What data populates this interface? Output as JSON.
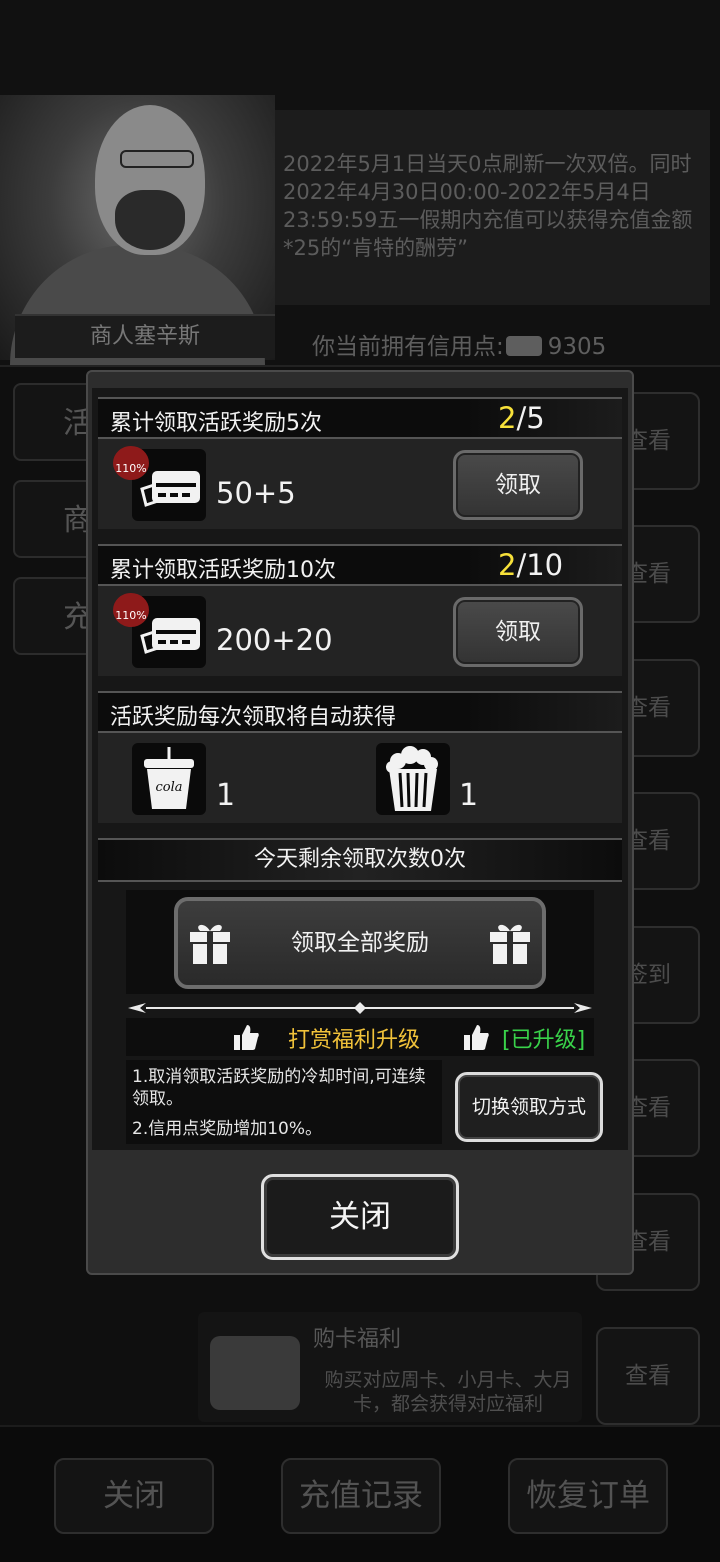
{
  "header": {
    "merchant_name": "商人塞辛斯",
    "notice": "2022年5月1日当天0点刷新一次双倍。同时2022年4月30日00:00-2022年5月4日23:59:59五一假期内充值可以获得充值金额*25的“肯特的酬劳”",
    "credit_label": "你当前拥有信用点:",
    "credit_value": "9305"
  },
  "background": {
    "left_tabs": [
      "活",
      "商",
      "充"
    ],
    "right_buttons": [
      "查看",
      "查看",
      "查看",
      "查看",
      "签到",
      "查看",
      "查看",
      "查看"
    ],
    "card_welfare": {
      "title": "购卡福利",
      "desc": "购买对应周卡、小月卡、大月卡，都会获得对应福利"
    },
    "bottom_buttons": [
      "关闭",
      "充值记录",
      "恢复订单"
    ]
  },
  "modal": {
    "tier1": {
      "title": "累计领取活跃奖励5次",
      "current": "2",
      "total": "/5",
      "amount": "50+5",
      "badge": "110%",
      "claim_label": "领取"
    },
    "tier2": {
      "title": "累计领取活跃奖励10次",
      "current": "2",
      "total": "/10",
      "amount": "200+20",
      "badge": "110%",
      "claim_label": "领取"
    },
    "auto": {
      "title": "活跃奖励每次领取将自动获得",
      "items": [
        {
          "icon": "cola-icon",
          "icon_text": "cola",
          "qty": "1"
        },
        {
          "icon": "popcorn-icon",
          "qty": "1"
        }
      ]
    },
    "remaining": "今天剩余领取次数0次",
    "claim_all_label": "领取全部奖励",
    "upgrade": {
      "title": "打赏福利升级",
      "status": "[已升级]",
      "desc1": "1.取消领取活跃奖励的冷却时间,可连续领取。",
      "desc2": "2.信用点奖励增加10%。",
      "switch_label": "切换领取方式"
    },
    "close_label": "关闭"
  },
  "colors": {
    "progress_current": "#f7e13a",
    "upgrade_title": "#f1c23a",
    "upgrade_status": "#39d24a",
    "badge": "#8e1a1a"
  }
}
